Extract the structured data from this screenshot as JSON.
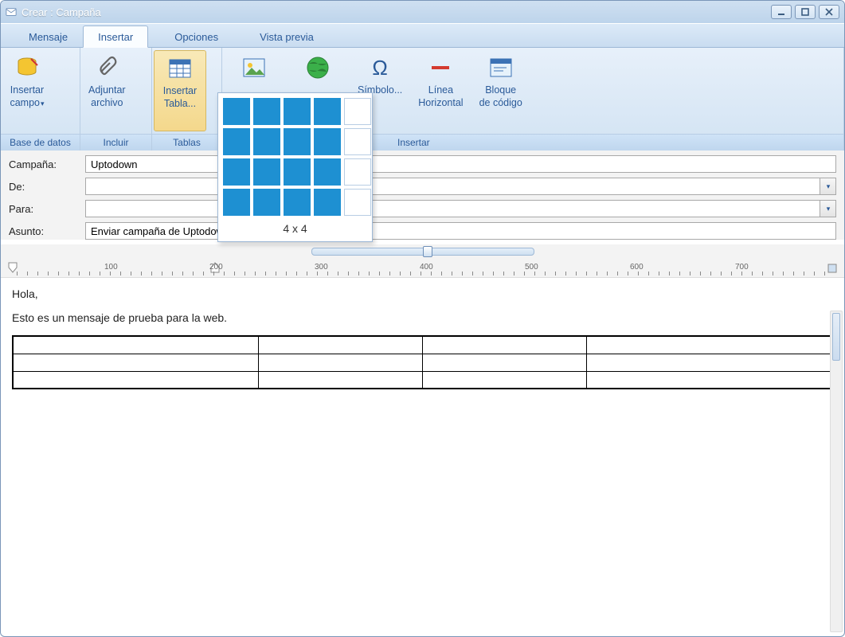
{
  "window": {
    "title": "Crear : Campaña"
  },
  "tabs": [
    {
      "label": "Mensaje"
    },
    {
      "label": "Insertar"
    },
    {
      "label": "Opciones"
    },
    {
      "label": "Vista previa"
    }
  ],
  "ribbon": {
    "groups": [
      {
        "label": "Base de datos",
        "buttons": [
          {
            "label": "Insertar\ncampo",
            "name": "insert-field",
            "hasDropdown": true
          }
        ]
      },
      {
        "label": "Incluir",
        "buttons": [
          {
            "label": "Adjuntar\narchivo",
            "name": "attach-file"
          }
        ]
      },
      {
        "label": "Tablas",
        "buttons": [
          {
            "label": "Insertar\nTabla...",
            "name": "insert-table",
            "active": true
          }
        ]
      },
      {
        "label": "Insertar",
        "buttons": [
          {
            "label": "",
            "name": "insert-image"
          },
          {
            "label": "",
            "name": "insert-link"
          },
          {
            "label": "Símbolo...",
            "name": "insert-symbol"
          },
          {
            "label": "Línea\nHorizontal",
            "name": "horizontal-line"
          },
          {
            "label": "Bloque\nde código",
            "name": "code-block"
          }
        ]
      }
    ]
  },
  "tablePopup": {
    "cols": 5,
    "rows": 4,
    "selCols": 4,
    "selRows": 4,
    "label": "4 x 4"
  },
  "form": {
    "campaign_label": "Campaña:",
    "campaign_value": "Uptodown",
    "from_label": "De:",
    "from_value": "",
    "to_label": "Para:",
    "to_value": "",
    "subject_label": "Asunto:",
    "subject_value": "Enviar campaña de Uptodown"
  },
  "ruler": {
    "marks": [
      "100",
      "200",
      "300",
      "400",
      "500",
      "600",
      "700"
    ]
  },
  "editor": {
    "greeting": "Hola,",
    "body": "Esto es un mensaje de prueba para la web.",
    "insertedTable": {
      "rows": 3,
      "cols": 4
    }
  }
}
